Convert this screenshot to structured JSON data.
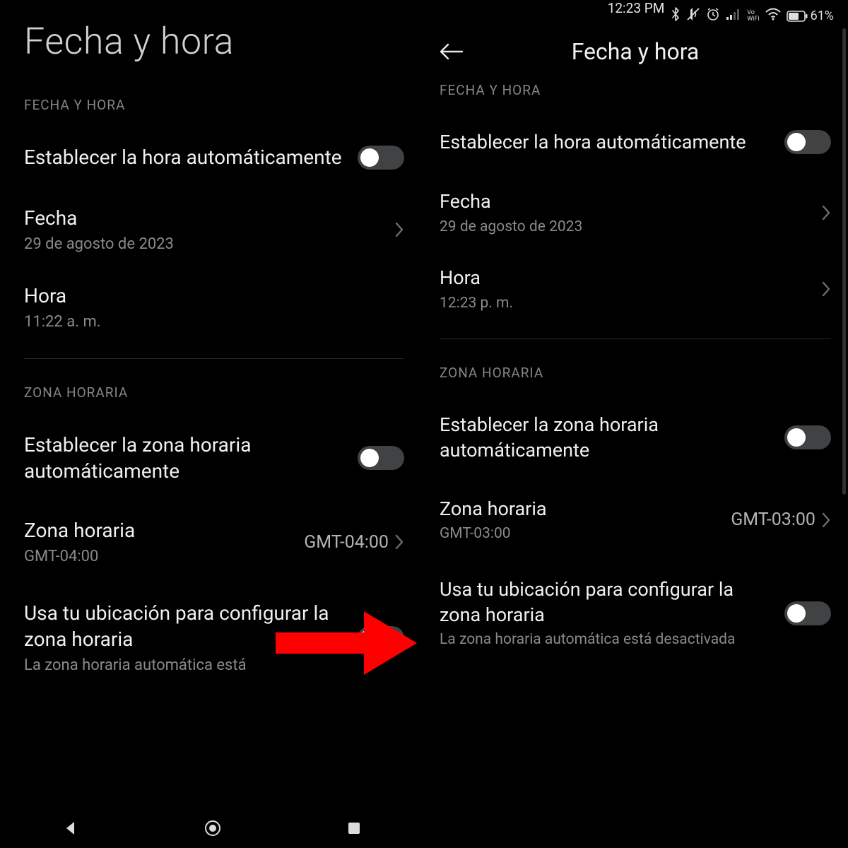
{
  "left": {
    "title": "Fecha y hora",
    "s1": {
      "header": "FECHA Y HORA",
      "autoTime": "Establecer la hora automáticamente",
      "dateLabel": "Fecha",
      "dateValue": "29 de agosto de 2023",
      "timeLabel": "Hora",
      "timeValue": "11:22 a. m."
    },
    "s2": {
      "header": "ZONA HORARIA",
      "autoTz": "Establecer la zona horaria automáticamente",
      "tzLabel": "Zona horaria",
      "tzSub": "GMT-04:00",
      "tzTrail": "GMT-04:00",
      "useLocation": "Usa tu ubicación para configurar la zona horaria",
      "useLocationSub": "La zona horaria automática está"
    }
  },
  "right": {
    "status": {
      "time": "12:23 PM",
      "voWifi": "Vo\nWiFi",
      "battery": "61%"
    },
    "appBarTitle": "Fecha y hora",
    "s1": {
      "header": "FECHA Y HORA",
      "autoTime": "Establecer la hora automáticamente",
      "dateLabel": "Fecha",
      "dateValue": "29 de agosto de 2023",
      "timeLabel": "Hora",
      "timeValue": "12:23 p. m."
    },
    "s2": {
      "header": "ZONA HORARIA",
      "autoTz": "Establecer la zona horaria automáticamente",
      "tzLabel": "Zona horaria",
      "tzSub": "GMT-03:00",
      "tzTrail": "GMT-03:00",
      "useLocation": "Usa tu ubicación para configurar la zona horaria",
      "useLocationSub": "La zona horaria automática está desactivada"
    }
  }
}
